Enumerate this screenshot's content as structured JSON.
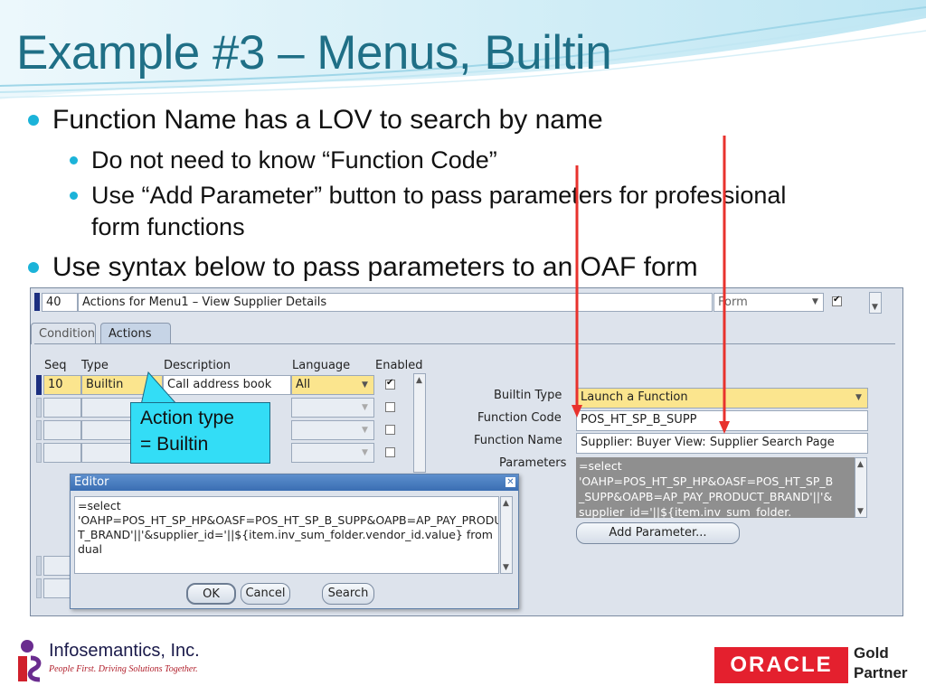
{
  "slide": {
    "title": "Example #3 – Menus, Builtin",
    "bullets": [
      "Function Name has a LOV to search by name",
      "Do not need to know “Function Code”",
      "Use “Add Parameter” button to pass parameters for professional",
      "form functions",
      "Use syntax below to pass parameters to an OAF form"
    ],
    "callout": [
      "Action type",
      "= Builtin"
    ]
  },
  "form": {
    "header": {
      "seq_value": "40",
      "description": "Actions for Menu1 – View Supplier Details",
      "type_value": "Form"
    },
    "tabs": [
      "Condition",
      "Actions"
    ],
    "columns": [
      "Seq",
      "Type",
      "Description",
      "Language",
      "Enabled"
    ],
    "row": {
      "seq": "10",
      "type": "Builtin",
      "description": "Call address book",
      "language": "All"
    },
    "fields": {
      "builtin_type_label": "Builtin Type",
      "builtin_type_value": "Launch a Function",
      "function_code_label": "Function Code",
      "function_code_value": "POS_HT_SP_B_SUPP",
      "function_name_label": "Function Name",
      "function_name_value": "Supplier: Buyer View: Supplier Search Page",
      "parameters_label": "Parameters",
      "parameters_value": "=select\n'OAHP=POS_HT_SP_HP&OASF=POS_HT_SP_B\n_SUPP&OAPB=AP_PAY_PRODUCT_BRAND'||'&\nsupplier_id='||${item.inv_sum_folder."
    },
    "add_parameter_label": "Add Parameter...",
    "editor": {
      "title": "Editor",
      "text": "=select\n'OAHP=POS_HT_SP_HP&OASF=POS_HT_SP_B_SUPP&OAPB=AP_PAY_PRODUC\nT_BRAND'||'&supplier_id='||${item.inv_sum_folder.vendor_id.value} from\ndual",
      "ok_label": "OK",
      "cancel_label": "Cancel",
      "search_label": "Search"
    }
  },
  "footer": {
    "company": "Infosemantics, Inc.",
    "tagline": "People First. Driving Solutions Together.",
    "oracle": "ORACLE",
    "partner_line1": "Gold",
    "partner_line2": "Partner"
  },
  "colors": {
    "title": "#1f6f86",
    "bullet_dot": "#1bb3d9",
    "callout": "#33ddf6",
    "arrow": "#e8322d",
    "oracle_red": "#e4202e"
  }
}
